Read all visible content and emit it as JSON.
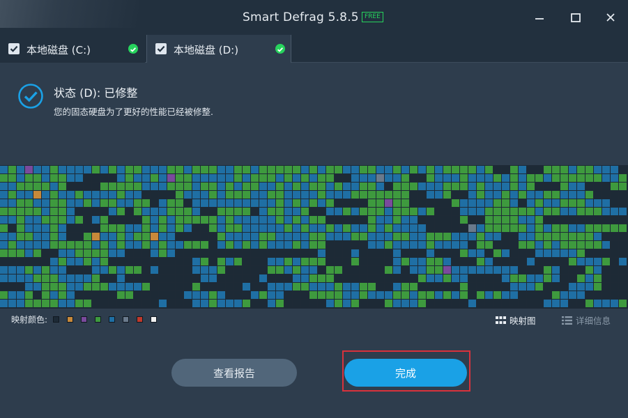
{
  "window": {
    "title": "Smart Defrag 5.8.5",
    "badge": "FREE"
  },
  "tabs": [
    {
      "label": "本地磁盘 (C:)",
      "checked": true,
      "status": "ok"
    },
    {
      "label": "本地磁盘 (D:)",
      "checked": true,
      "status": "ok",
      "active": true
    }
  ],
  "status": {
    "title": "状态 (D): 已修整",
    "description": "您的固态硬盘为了更好的性能已经被修整."
  },
  "legend": {
    "label": "映射颜色:",
    "colors": [
      "#1d2a36",
      "#c8893a",
      "#7a4a9c",
      "#3e9a3e",
      "#1f6fa4",
      "#6a7a8c",
      "#c0392b",
      "#f2f2f2"
    ]
  },
  "views": {
    "map_label": "映射图",
    "info_label": "详细信息"
  },
  "buttons": {
    "report": "查看报告",
    "done": "完成"
  },
  "colors": {
    "accent": "#1aa1e6",
    "ok_green": "#27d35d",
    "highlight_frame": "#d9323c"
  }
}
